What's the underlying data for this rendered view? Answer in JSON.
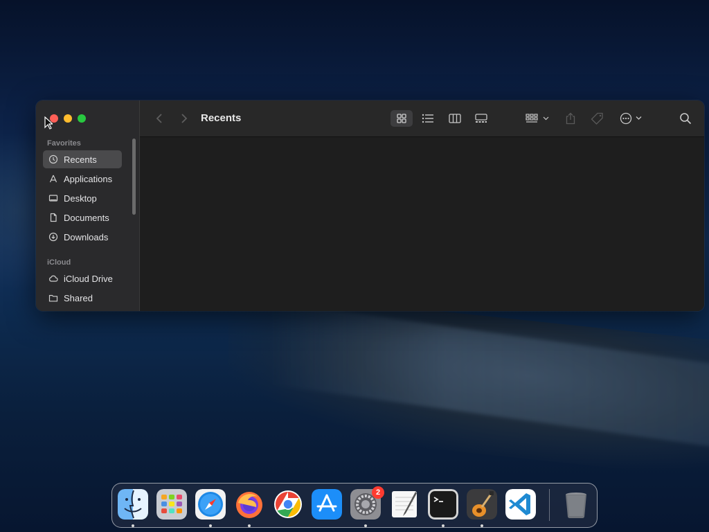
{
  "window": {
    "title": "Recents",
    "view_mode": "icons"
  },
  "sidebar": {
    "sections": [
      {
        "label": "Favorites"
      },
      {
        "label": "iCloud"
      }
    ],
    "items": [
      {
        "label": "Recents",
        "icon": "clock-icon",
        "selected": true
      },
      {
        "label": "Applications",
        "icon": "applications-icon",
        "selected": false
      },
      {
        "label": "Desktop",
        "icon": "desktop-icon",
        "selected": false
      },
      {
        "label": "Documents",
        "icon": "document-icon",
        "selected": false
      },
      {
        "label": "Downloads",
        "icon": "download-icon",
        "selected": false
      },
      {
        "label": "iCloud Drive",
        "icon": "cloud-icon",
        "selected": false
      },
      {
        "label": "Shared",
        "icon": "shared-folder-icon",
        "selected": false
      }
    ]
  },
  "toolbar": {
    "buttons": [
      "back",
      "forward",
      "icon-view",
      "list-view",
      "column-view",
      "gallery-view",
      "group-by",
      "share",
      "tags",
      "more-actions",
      "search"
    ]
  },
  "dock": {
    "apps": [
      {
        "name": "Finder",
        "running": true
      },
      {
        "name": "Launchpad",
        "running": false
      },
      {
        "name": "Safari",
        "running": true
      },
      {
        "name": "Firefox",
        "running": true
      },
      {
        "name": "Google Chrome",
        "running": false
      },
      {
        "name": "App Store",
        "running": false
      },
      {
        "name": "System Preferences",
        "running": true,
        "badge": "2"
      },
      {
        "name": "TextEdit",
        "running": false
      },
      {
        "name": "Terminal",
        "running": true
      },
      {
        "name": "GarageBand",
        "running": true
      },
      {
        "name": "Visual Studio Code",
        "running": false
      },
      {
        "name": "Trash",
        "running": false
      }
    ]
  },
  "colors": {
    "close": "#fe5f57",
    "minimize": "#febc2e",
    "zoom": "#28c840",
    "badge": "#ff3b30"
  }
}
